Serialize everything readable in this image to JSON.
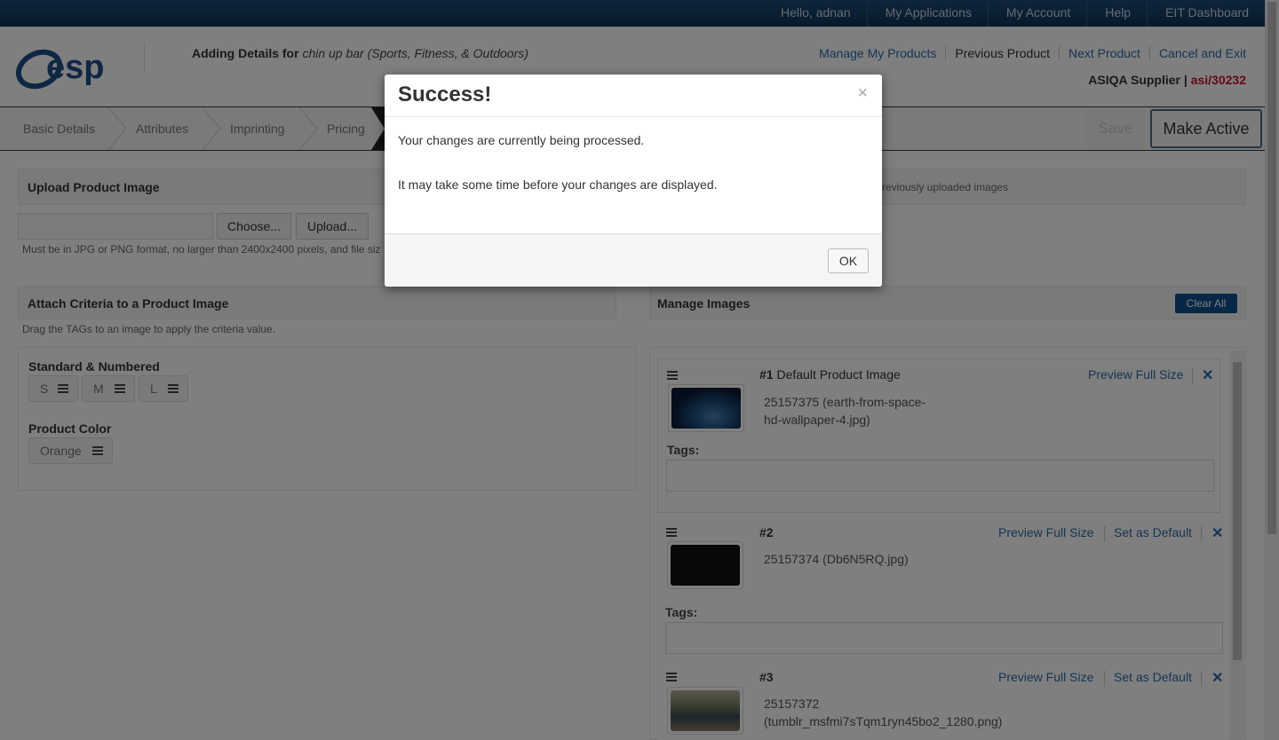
{
  "topbar": {
    "greeting": "Hello, adnan",
    "links": [
      "My Applications",
      "My Account",
      "Help",
      "EIT Dashboard"
    ]
  },
  "header": {
    "logo_text": "esp",
    "adding_prefix": "Adding Details for",
    "product": "chin up bar (Sports, Fitness, & Outdoors)",
    "links": [
      "Manage My Products",
      "Previous Product",
      "Next Product",
      "Cancel and Exit"
    ],
    "supplier_label": "ASIQA Supplier |",
    "supplier_code": "asi/30232"
  },
  "tabs": [
    "Basic Details",
    "Attributes",
    "Imprinting",
    "Pricing"
  ],
  "actions": {
    "save": "Save",
    "make_active": "Make Active"
  },
  "upload": {
    "title": "Upload Product Image",
    "choose": "Choose...",
    "upload": "Upload...",
    "hint": "Must be in JPG or PNG format, no larger than 2400x2400 pixels, and file siz",
    "previous_hint": "reviously uploaded images"
  },
  "criteria": {
    "title": "Attach Criteria to a Product Image",
    "hint": "Drag the TAGs to an image to apply the criteria value.",
    "groups": [
      {
        "label": "Standard & Numbered",
        "tags": [
          "S",
          "M",
          "L"
        ]
      },
      {
        "label": "Product Color",
        "tags": [
          "Orange"
        ]
      }
    ]
  },
  "manage": {
    "title": "Manage Images",
    "clear_all": "Clear All",
    "tags_label": "Tags:",
    "preview": "Preview Full Size",
    "set_default": "Set as Default",
    "images": [
      {
        "num": "#1",
        "title": "Default Product Image",
        "file_line1": "25157375 (earth-from-space-",
        "file_line2": "hd-wallpaper-4.jpg)"
      },
      {
        "num": "#2",
        "title": "",
        "file_line1": "25157374 (Db6N5RQ.jpg)",
        "file_line2": ""
      },
      {
        "num": "#3",
        "title": "",
        "file_line1": "25157372",
        "file_line2": "(tumblr_msfmi7sTqm1ryn45bo2_1280.png)"
      }
    ]
  },
  "modal": {
    "title": "Success!",
    "close": "×",
    "line1": "Your changes are currently being processed.",
    "line2": "It may take some time before your changes are displayed.",
    "ok": "OK"
  }
}
